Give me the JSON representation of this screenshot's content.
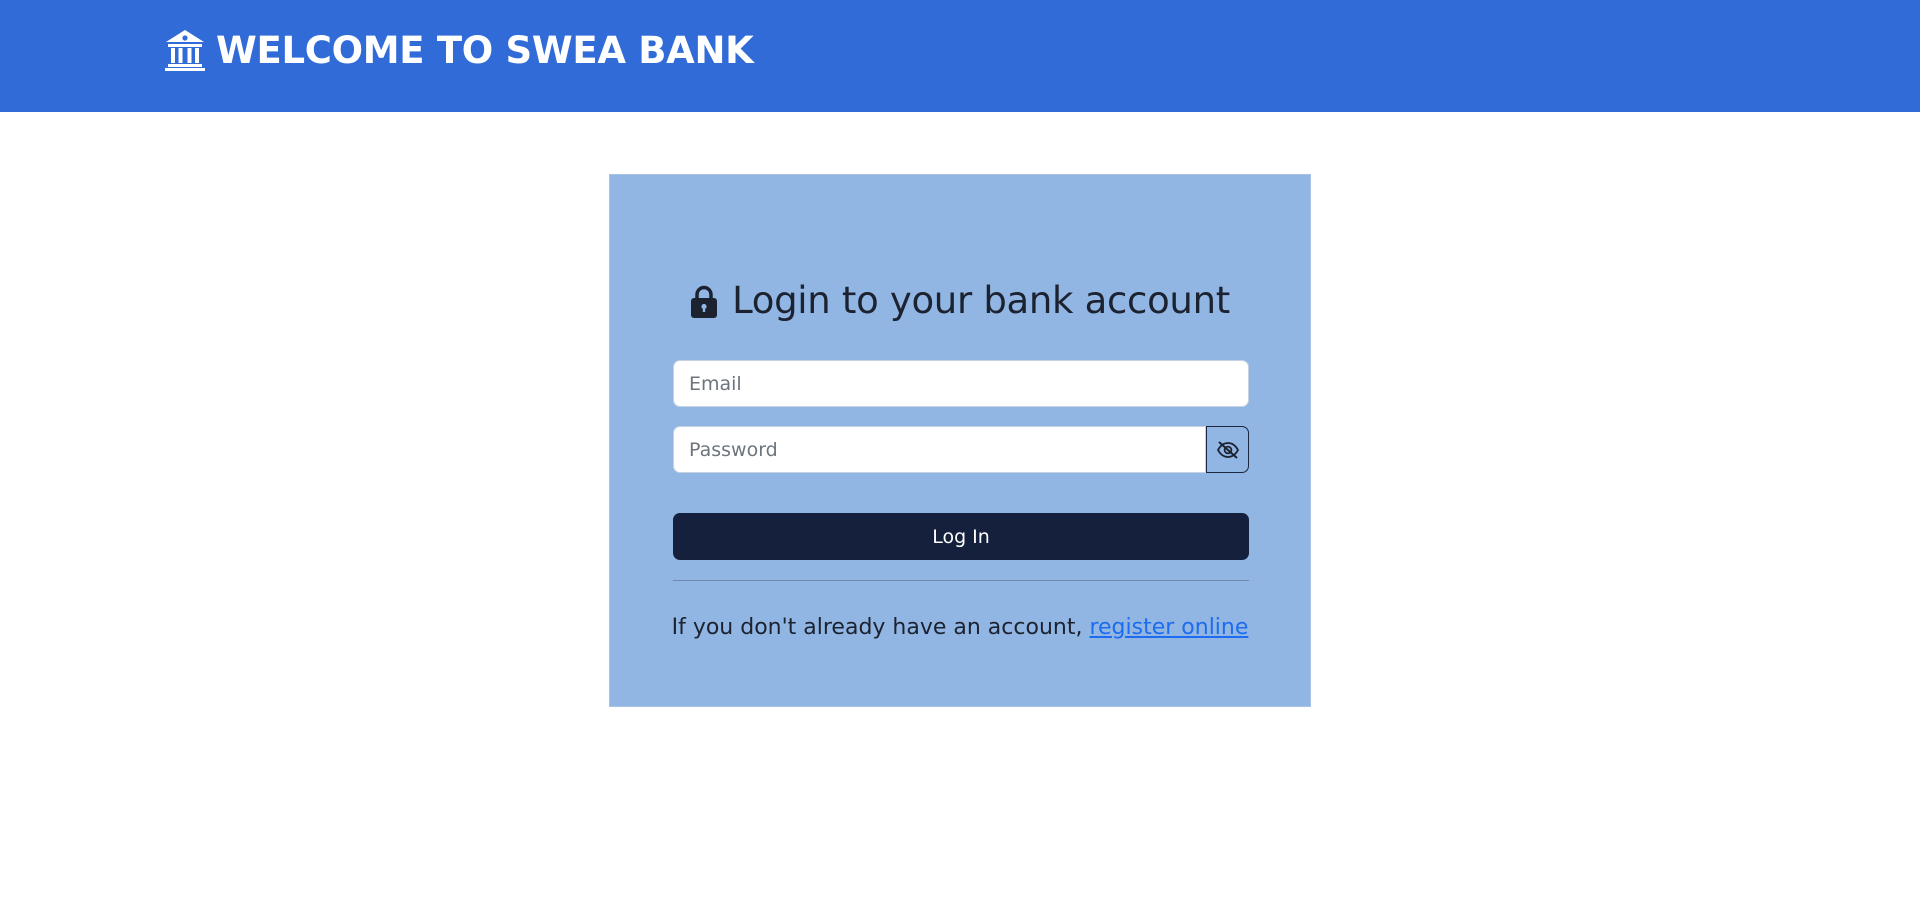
{
  "header": {
    "title": "WELCOME TO SWEA BANK",
    "icon": "bank-icon",
    "background_color": "#306bd8"
  },
  "login_card": {
    "heading": "Login to your bank account",
    "heading_icon": "lock-icon",
    "background_color": "#91b6e3",
    "email": {
      "placeholder": "Email",
      "value": ""
    },
    "password": {
      "placeholder": "Password",
      "value": "",
      "toggle_icon": "eye-slash-icon"
    },
    "login_button": {
      "label": "Log In",
      "color": "#14203c"
    },
    "register": {
      "prompt": "If you don't already have an account, ",
      "link_text": "register online",
      "link_color": "#1d6cf0"
    }
  }
}
